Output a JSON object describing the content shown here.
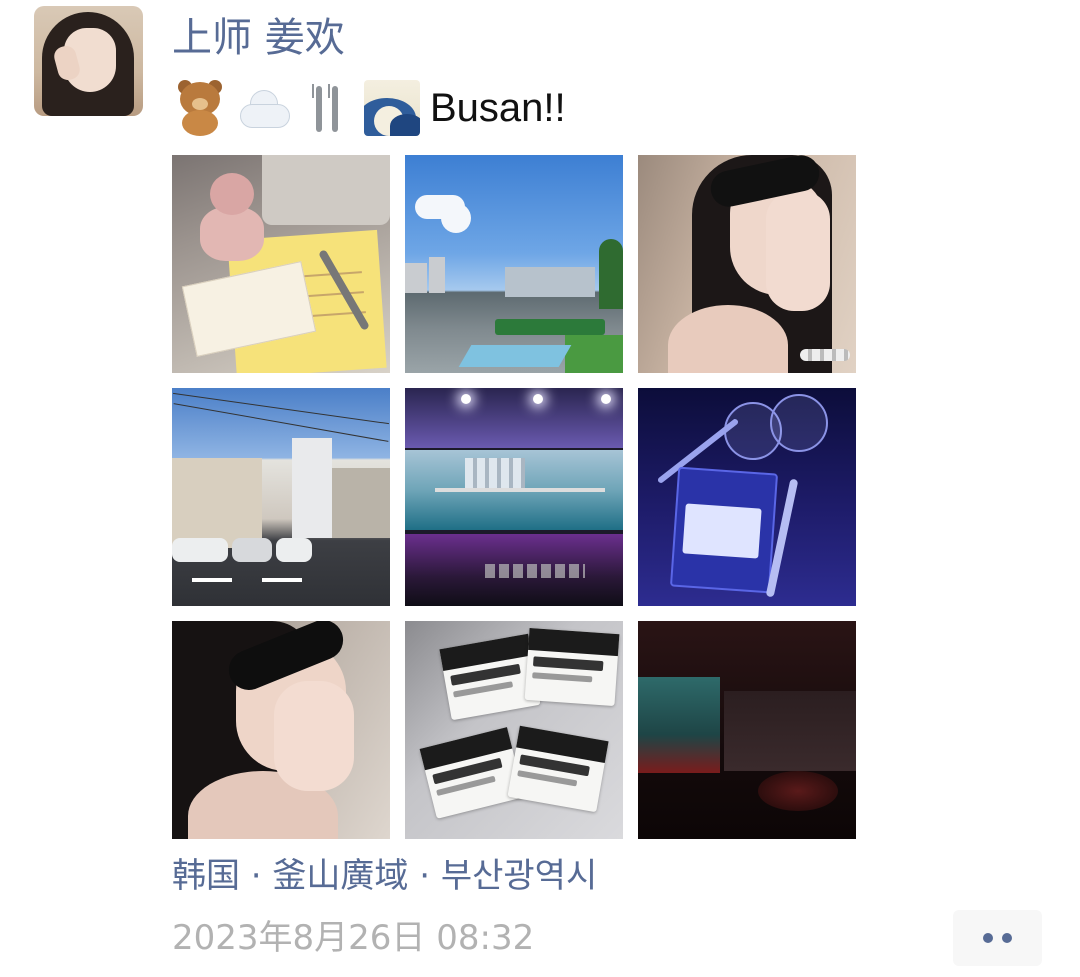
{
  "post": {
    "username": "上师 姜欢",
    "caption": {
      "emojis": [
        "teddy-bear",
        "cloud",
        "fork-and-knife",
        "water-wave"
      ],
      "text": "Busan!!"
    },
    "photos": [
      {
        "subject": "plush-and-documents"
      },
      {
        "subject": "city-parking-lot"
      },
      {
        "subject": "selfie-sunglasses"
      },
      {
        "subject": "street-view"
      },
      {
        "subject": "event-stage-screen"
      },
      {
        "subject": "name-badge-dinner"
      },
      {
        "subject": "selfie-sunglasses-2"
      },
      {
        "subject": "name-badges"
      },
      {
        "subject": "dark-lounge"
      }
    ],
    "badges": [
      {
        "name": "Leyi Wang"
      },
      {
        "name": "Zijie Zhang"
      },
      {
        "name": "Yubing Hu"
      },
      {
        "name": "Huan Jiang"
      }
    ],
    "location": "韩国 · 釜山廣域 · 부산광역시",
    "timestamp": "2023年8月26日 08:32"
  },
  "colors": {
    "link": "#576b95",
    "meta": "#b2b2b2",
    "text": "#111111"
  }
}
